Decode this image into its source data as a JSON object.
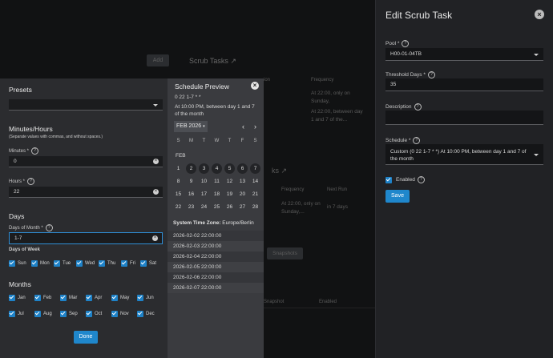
{
  "background": {
    "add_button": "Add",
    "scrub_tasks_title": "Scrub Tasks",
    "frequency_header": "Frequency",
    "frequency_header_2": "Frequency",
    "next_run_header": "Next Run",
    "frequency_text_1": "At 22:00, only on Sunday,",
    "frequency_text_2": "At 22:00, between day 1 and 7 of the...",
    "frequency_text_3": "At 22:00, only on Sunday,...",
    "next_run_value": "in 7 days",
    "snapshots_button": "Snapshots",
    "snapshot_header": "Snapshot",
    "enabled_header": "Enabled"
  },
  "edit_panel": {
    "title": "Edit Scrub Task",
    "pool_label": "Pool *",
    "pool_value": "H00-01-04TB",
    "threshold_label": "Threshold Days *",
    "threshold_value": "35",
    "description_label": "Description",
    "description_value": "",
    "schedule_label": "Schedule *",
    "schedule_value": "Custom (0 22 1-7 * *) At 10:00 PM, between day 1 and 7 of the month",
    "enabled_label": "Enabled",
    "save_label": "Save"
  },
  "scheduler": {
    "presets_label": "Presets",
    "presets_value": "",
    "minutes_hours_title": "Minutes/Hours",
    "minutes_hours_hint": "(Separate values with commas, and without spaces.)",
    "minutes_label": "Minutes *",
    "minutes_value": "0",
    "hours_label": "Hours *",
    "hours_value": "22",
    "days_title": "Days",
    "days_of_month_label": "Days of Month *",
    "days_of_month_value": "1-7",
    "days_of_week_label": "Days of Week",
    "days_of_week": [
      "Sun",
      "Mon",
      "Tue",
      "Wed",
      "Thu",
      "Fri",
      "Sat"
    ],
    "months_title": "Months",
    "months_row1": [
      "Jan",
      "Feb",
      "Mar",
      "Apr",
      "May",
      "Jun"
    ],
    "months_row2": [
      "Jul",
      "Aug",
      "Sep",
      "Oct",
      "Nov",
      "Dec"
    ],
    "done_label": "Done"
  },
  "preview": {
    "title": "Schedule Preview",
    "cron": "0 22 1-7 * *",
    "description": "At 10:00 PM, between day 1 and 7 of the month",
    "month_selector": "FEB 2026",
    "weekdays": [
      "S",
      "M",
      "T",
      "W",
      "T",
      "F",
      "S"
    ],
    "month_label": "FEB",
    "weeks": [
      [
        "1",
        "2",
        "3",
        "4",
        "5",
        "6",
        "7"
      ],
      [
        "8",
        "9",
        "10",
        "11",
        "12",
        "13",
        "14"
      ],
      [
        "15",
        "16",
        "17",
        "18",
        "19",
        "20",
        "21"
      ],
      [
        "22",
        "23",
        "24",
        "25",
        "26",
        "27",
        "28"
      ]
    ],
    "timezone_label": "System Time Zone:",
    "timezone_value": "Europe/Berlin",
    "runs": [
      "2026-02-02 22:00:00",
      "2026-02-03 22:00:00",
      "2026-02-04 22:00:00",
      "2026-02-05 22:00:00",
      "2026-02-06 22:00:00",
      "2026-02-07 22:00:00"
    ]
  }
}
